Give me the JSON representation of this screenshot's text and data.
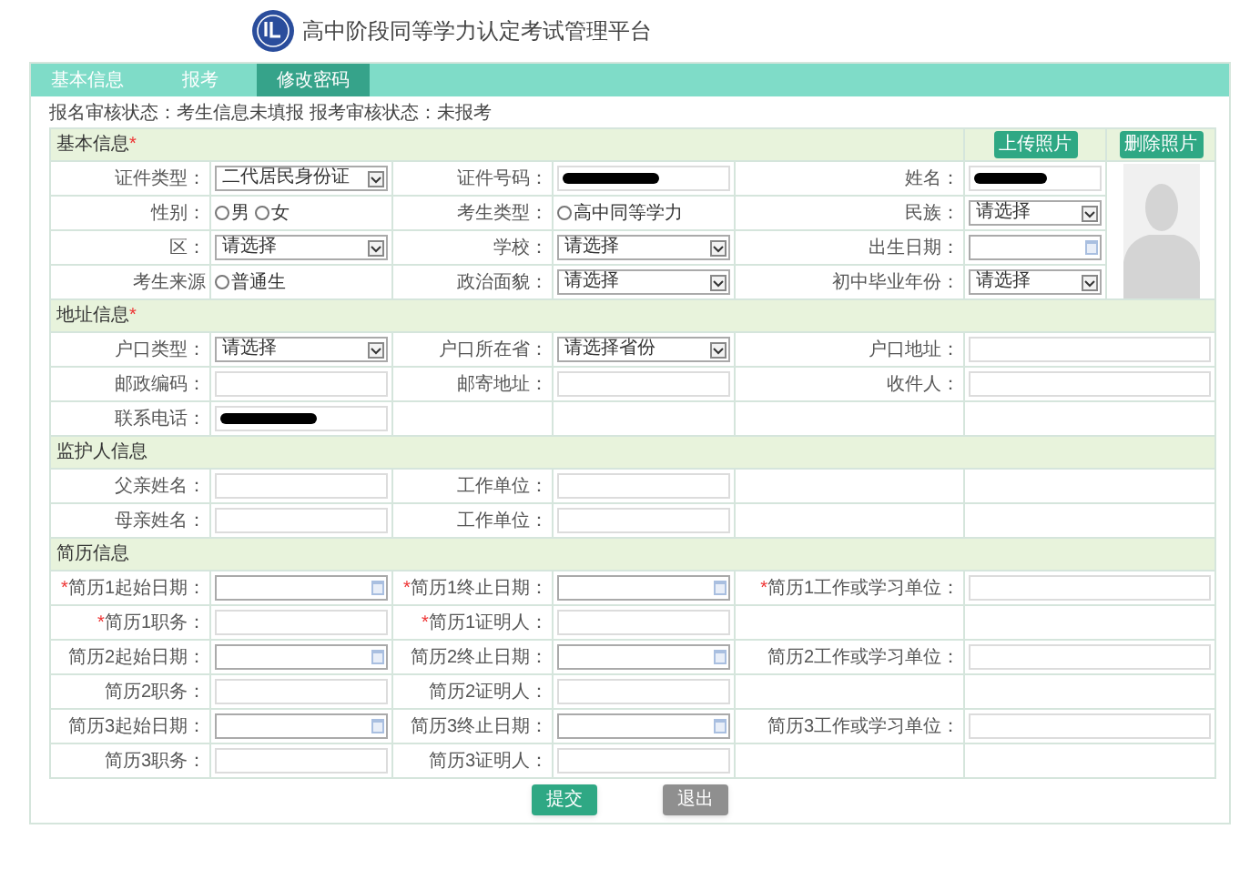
{
  "header": {
    "title": "高中阶段同等学力认定考试管理平台"
  },
  "tabs": [
    {
      "label": "基本信息",
      "selected": false
    },
    {
      "label": "报考",
      "selected": false
    },
    {
      "label": "修改密码",
      "selected": true
    }
  ],
  "status_text": "报名审核状态：考生信息未填报 报考审核状态：未报考",
  "sections": [
    {
      "title": "基本信息",
      "required_mark": "*",
      "buttons": [
        "上传照片",
        "删除照片"
      ],
      "photo": {
        "kind": "silhouette"
      },
      "rows": [
        [
          {
            "label": "证件类型：",
            "field": {
              "kind": "select",
              "value": "二代居民身份证"
            }
          },
          {
            "label": "证件号码：",
            "field": {
              "kind": "redacted"
            }
          },
          {
            "label": "姓名：",
            "field": {
              "kind": "redacted"
            }
          }
        ],
        [
          {
            "label": "性别：",
            "field": {
              "kind": "radio",
              "options": [
                {
                  "label": "男",
                  "checked": false
                },
                {
                  "label": "女",
                  "checked": false
                }
              ]
            }
          },
          {
            "label": "考生类型：",
            "field": {
              "kind": "radio",
              "options": [
                {
                  "label": "高中同等学力",
                  "checked": false
                }
              ]
            }
          },
          {
            "label": "民族：",
            "field": {
              "kind": "select",
              "value": "请选择"
            }
          }
        ],
        [
          {
            "label": "区：",
            "field": {
              "kind": "select",
              "value": "请选择"
            }
          },
          {
            "label": "学校：",
            "field": {
              "kind": "select",
              "value": "请选择"
            }
          },
          {
            "label": "出生日期：",
            "field": {
              "kind": "date"
            }
          }
        ],
        [
          {
            "label": "考生来源",
            "field": {
              "kind": "radio",
              "options": [
                {
                  "label": "普通生",
                  "checked": false
                }
              ]
            }
          },
          {
            "label": "政治面貌：",
            "field": {
              "kind": "select",
              "value": "请选择"
            }
          },
          {
            "label": "初中毕业年份：",
            "field": {
              "kind": "select",
              "value": "请选择"
            }
          }
        ]
      ]
    },
    {
      "title": "地址信息",
      "required_mark": "*",
      "rows": [
        [
          {
            "label": "户口类型：",
            "field": {
              "kind": "select",
              "value": "请选择"
            }
          },
          {
            "label": "户口所在省：",
            "field": {
              "kind": "select",
              "value": "请选择省份"
            }
          },
          {
            "label": "户口地址：",
            "field": {
              "kind": "text"
            }
          }
        ],
        [
          {
            "label": "邮政编码：",
            "field": {
              "kind": "text"
            }
          },
          {
            "label": "邮寄地址：",
            "field": {
              "kind": "text"
            }
          },
          {
            "label": "收件人：",
            "field": {
              "kind": "text"
            }
          }
        ],
        [
          {
            "label": "联系电话：",
            "field": {
              "kind": "redacted"
            }
          }
        ]
      ]
    },
    {
      "title": "监护人信息",
      "rows": [
        [
          {
            "label": "父亲姓名：",
            "field": {
              "kind": "text"
            }
          },
          {
            "label": "工作单位：",
            "field": {
              "kind": "text"
            }
          }
        ],
        [
          {
            "label": "母亲姓名：",
            "field": {
              "kind": "text"
            }
          },
          {
            "label": "工作单位：",
            "field": {
              "kind": "text"
            }
          }
        ]
      ]
    },
    {
      "title": "简历信息",
      "rows": [
        [
          {
            "required_mark": "*",
            "label": "简历1起始日期：",
            "field": {
              "kind": "date"
            }
          },
          {
            "required_mark": "*",
            "label": "简历1终止日期：",
            "field": {
              "kind": "date"
            }
          },
          {
            "required_mark": "*",
            "label": "简历1工作或学习单位：",
            "field": {
              "kind": "text"
            }
          }
        ],
        [
          {
            "required_mark": "*",
            "label": "简历1职务：",
            "field": {
              "kind": "text"
            }
          },
          {
            "required_mark": "*",
            "label": "简历1证明人：",
            "field": {
              "kind": "text"
            }
          }
        ],
        [
          {
            "label": "简历2起始日期：",
            "field": {
              "kind": "date"
            }
          },
          {
            "label": "简历2终止日期：",
            "field": {
              "kind": "date"
            }
          },
          {
            "label": "简历2工作或学习单位：",
            "field": {
              "kind": "text"
            }
          }
        ],
        [
          {
            "label": "简历2职务：",
            "field": {
              "kind": "text"
            }
          },
          {
            "label": "简历2证明人：",
            "field": {
              "kind": "text"
            }
          }
        ],
        [
          {
            "label": "简历3起始日期：",
            "field": {
              "kind": "date"
            }
          },
          {
            "label": "简历3终止日期：",
            "field": {
              "kind": "date"
            }
          },
          {
            "label": "简历3工作或学习单位：",
            "field": {
              "kind": "text"
            }
          }
        ],
        [
          {
            "label": "简历3职务：",
            "field": {
              "kind": "text"
            }
          },
          {
            "label": "简历3证明人：",
            "field": {
              "kind": "text"
            }
          }
        ]
      ]
    }
  ],
  "actions": [
    {
      "label": "提交",
      "kind": "primary"
    },
    {
      "label": "退出",
      "kind": "secondary"
    }
  ]
}
